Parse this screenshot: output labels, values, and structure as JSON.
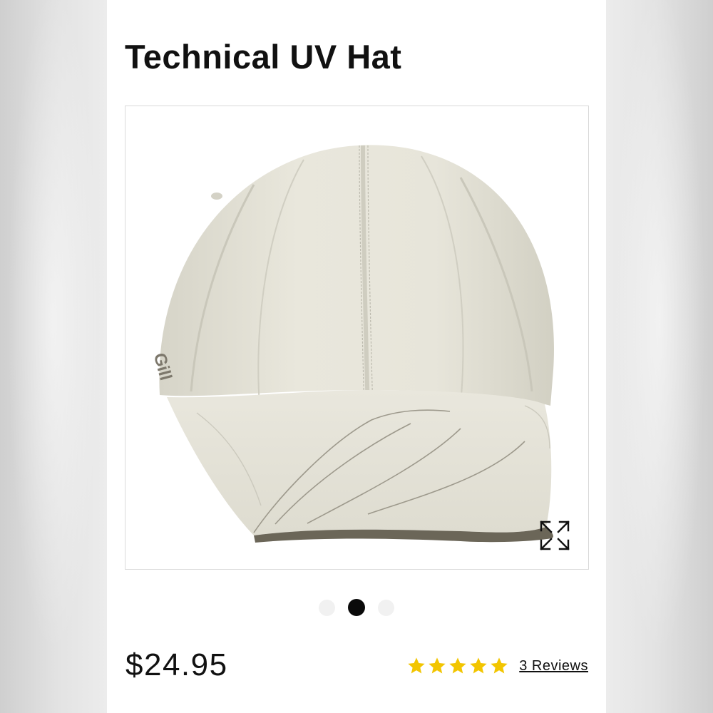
{
  "product": {
    "title": "Technical UV Hat",
    "price": "$24.95",
    "image_alt": "beige baseball cap with Gill logo",
    "logo_text": "Gill"
  },
  "gallery": {
    "total_images": 3,
    "active_index": 1,
    "expand_icon": "expand-arrows-icon"
  },
  "rating": {
    "stars": 5,
    "star_icon": "star-icon",
    "star_color": "#f2c500",
    "reviews_label": "3 Reviews"
  },
  "colors": {
    "hat": "#e4e2d6",
    "hat_shade": "#d3d1c4",
    "brim_binding": "#6b6658",
    "active_dot": "#0a0a0a",
    "inactive_dot": "#f1f1f1"
  }
}
